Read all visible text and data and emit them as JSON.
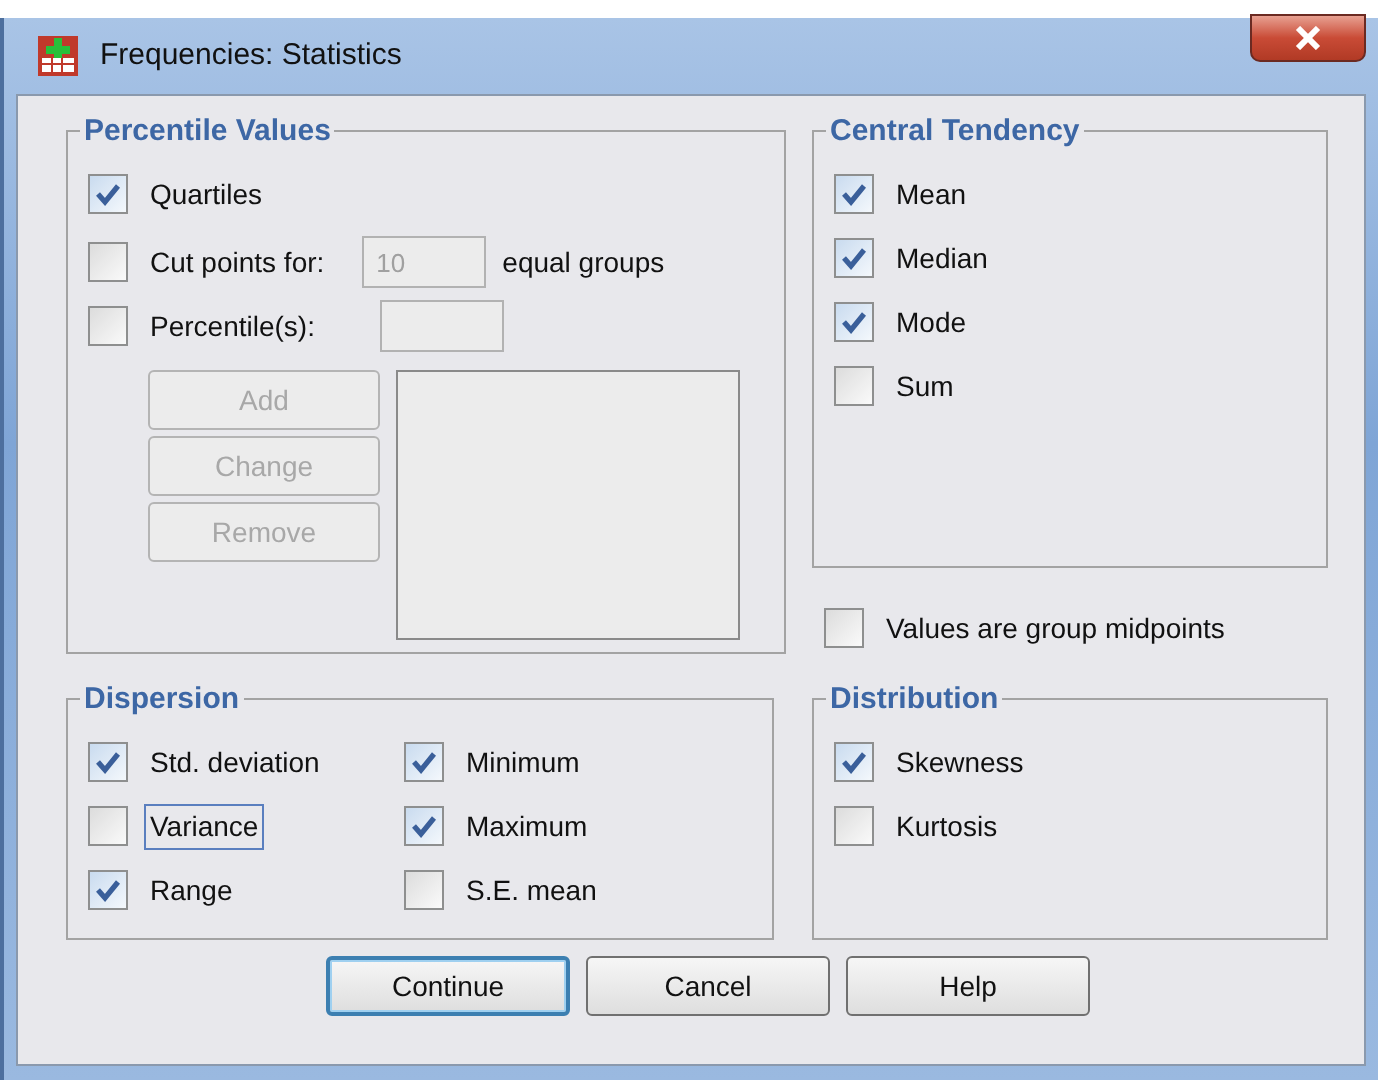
{
  "window": {
    "title": "Frequencies: Statistics"
  },
  "percentile_values": {
    "title": "Percentile Values",
    "quartiles": {
      "label": "Quartiles",
      "checked": true
    },
    "cut_points": {
      "label": "Cut points for:",
      "checked": false,
      "value": "10",
      "disabled": true,
      "suffix": "equal groups"
    },
    "percentiles": {
      "label": "Percentile(s):",
      "checked": false,
      "disabled": true
    },
    "buttons": [
      {
        "label": "Add",
        "disabled": true
      },
      {
        "label": "Change",
        "disabled": true
      },
      {
        "label": "Remove",
        "disabled": true
      }
    ]
  },
  "central_tendency": {
    "title": "Central Tendency",
    "items": [
      {
        "label": "Mean",
        "checked": true
      },
      {
        "label": "Median",
        "checked": true
      },
      {
        "label": "Mode",
        "checked": true
      },
      {
        "label": "Sum",
        "checked": false
      }
    ]
  },
  "group_midpoints": {
    "label": "Values are group midpoints",
    "checked": false
  },
  "dispersion": {
    "title": "Dispersion",
    "items": [
      {
        "label": "Std. deviation",
        "checked": true,
        "focused": false
      },
      {
        "label": "Minimum",
        "checked": true,
        "focused": false
      },
      {
        "label": "Variance",
        "checked": false,
        "focused": true
      },
      {
        "label": "Maximum",
        "checked": true,
        "focused": false
      },
      {
        "label": "Range",
        "checked": true,
        "focused": false
      },
      {
        "label": "S.E. mean",
        "checked": false,
        "focused": false
      }
    ]
  },
  "distribution": {
    "title": "Distribution",
    "items": [
      {
        "label": "Skewness",
        "checked": true
      },
      {
        "label": "Kurtosis",
        "checked": false
      }
    ]
  },
  "buttons": [
    {
      "label": "Continue",
      "default": true
    },
    {
      "label": "Cancel",
      "default": false
    },
    {
      "label": "Help",
      "default": false
    }
  ]
}
